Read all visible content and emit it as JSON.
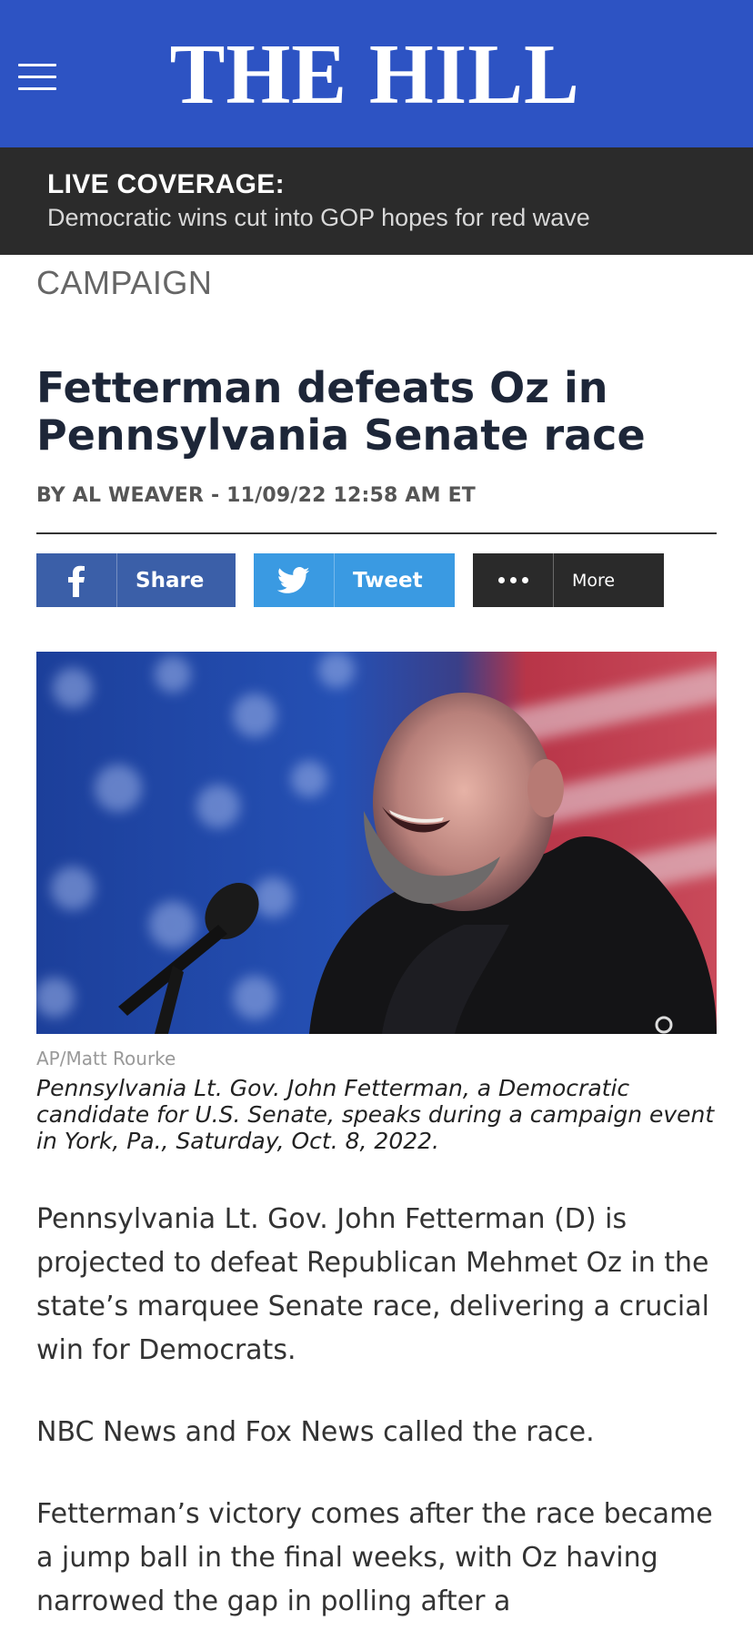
{
  "header": {
    "logo": "THE HILL",
    "menu_icon": "hamburger-menu-icon",
    "background": "#2d53c3"
  },
  "live": {
    "label": "LIVE COVERAGE:",
    "headline": "Democratic wins cut into GOP hopes for red wave"
  },
  "article": {
    "category": "CAMPAIGN",
    "title": "Fetterman defeats Oz in Pennsylvania Senate race",
    "byline": "BY AL WEAVER - 11/09/22 12:58 AM ET",
    "share": {
      "facebook_label": "Share",
      "twitter_label": "Tweet",
      "more_label": "More",
      "facebook_color": "#3b5fa8",
      "twitter_color": "#3a9ae2",
      "more_color": "#2a2a2a"
    },
    "photo": {
      "credit": "AP/Matt Rourke",
      "caption": "Pennsylvania Lt. Gov. John Fetterman, a Democratic candidate for U.S. Senate, speaks during a campaign event in York, Pa., Saturday, Oct. 8, 2022."
    },
    "paragraphs": [
      "Pennsylvania Lt. Gov. John Fetterman (D) is projected to defeat Republican Mehmet Oz in the state’s marquee Senate race, delivering a crucial win for Democrats.",
      "NBC News and Fox News called the race.",
      "Fetterman’s victory comes after the race became a jump ball in the final weeks, with Oz having narrowed the gap in polling after a"
    ]
  }
}
